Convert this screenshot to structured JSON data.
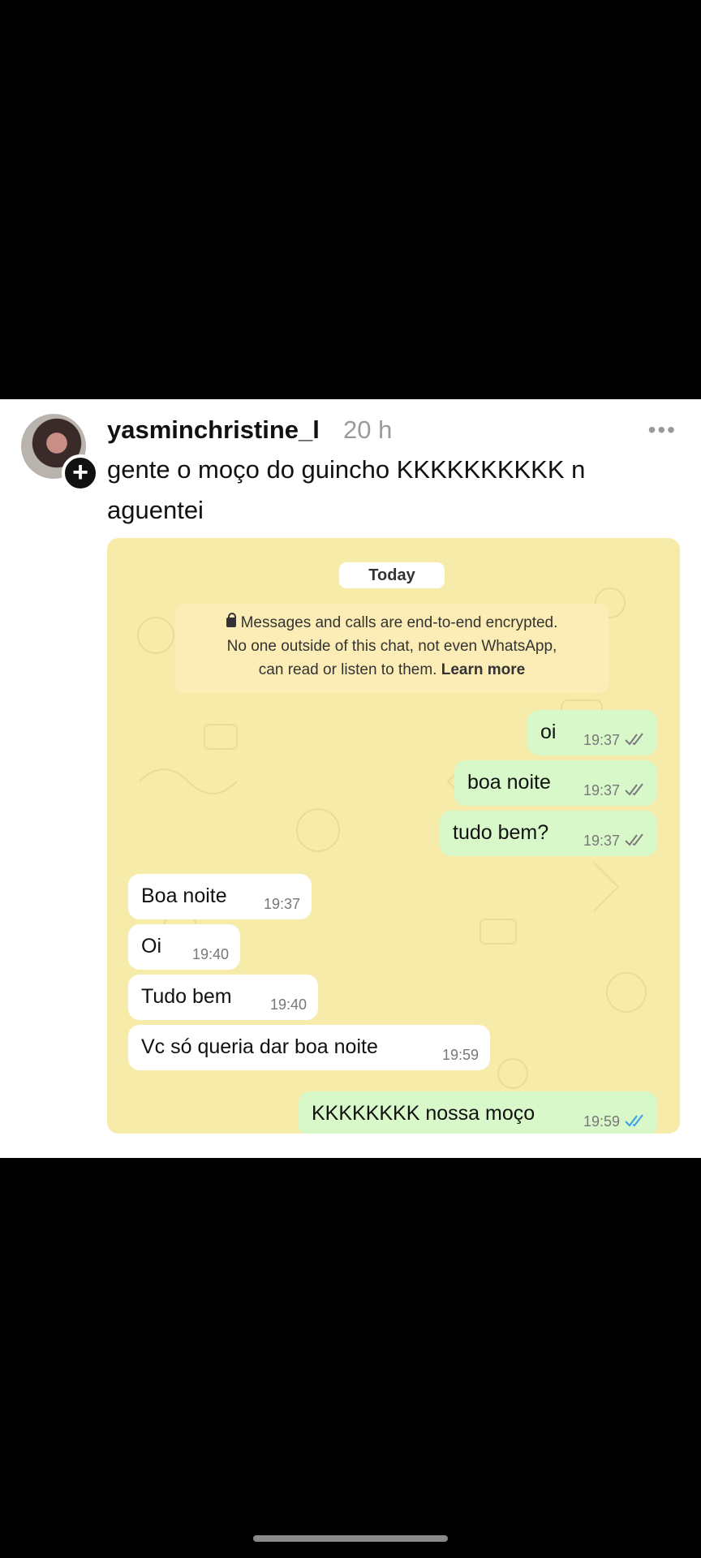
{
  "post": {
    "username": "yasminchristine_l",
    "time": "20 h",
    "caption": "gente o moço do guincho KKKKKKKKKK n aguentei"
  },
  "chat": {
    "date_chip": "Today",
    "notice_line1": "Messages and calls are end-to-end encrypted.",
    "notice_line2": "No one outside of this chat, not even WhatsApp,",
    "notice_line3": "can read or listen to them.",
    "notice_link": "Learn more",
    "messages": [
      {
        "dir": "out",
        "text": "oi",
        "time": "19:37",
        "status": "delivered"
      },
      {
        "dir": "out",
        "text": "boa noite",
        "time": "19:37",
        "status": "delivered"
      },
      {
        "dir": "out",
        "text": "tudo bem?",
        "time": "19:37",
        "status": "delivered"
      },
      {
        "dir": "in",
        "text": "Boa noite",
        "time": "19:37"
      },
      {
        "dir": "in",
        "text": "Oi",
        "time": "19:40"
      },
      {
        "dir": "in",
        "text": "Tudo bem",
        "time": "19:40"
      },
      {
        "dir": "in",
        "text": "Vc só queria dar boa noite",
        "time": "19:59"
      },
      {
        "dir": "out",
        "text": "KKKKKKKK nossa moço",
        "time": "19:59",
        "status": "read"
      }
    ]
  },
  "colors": {
    "chat_bg": "#f6eba8",
    "outgoing_bubble": "#d8f8c9",
    "incoming_bubble": "#ffffff",
    "read_ticks": "#3b9de8",
    "delivered_ticks": "#7a7a7a"
  }
}
